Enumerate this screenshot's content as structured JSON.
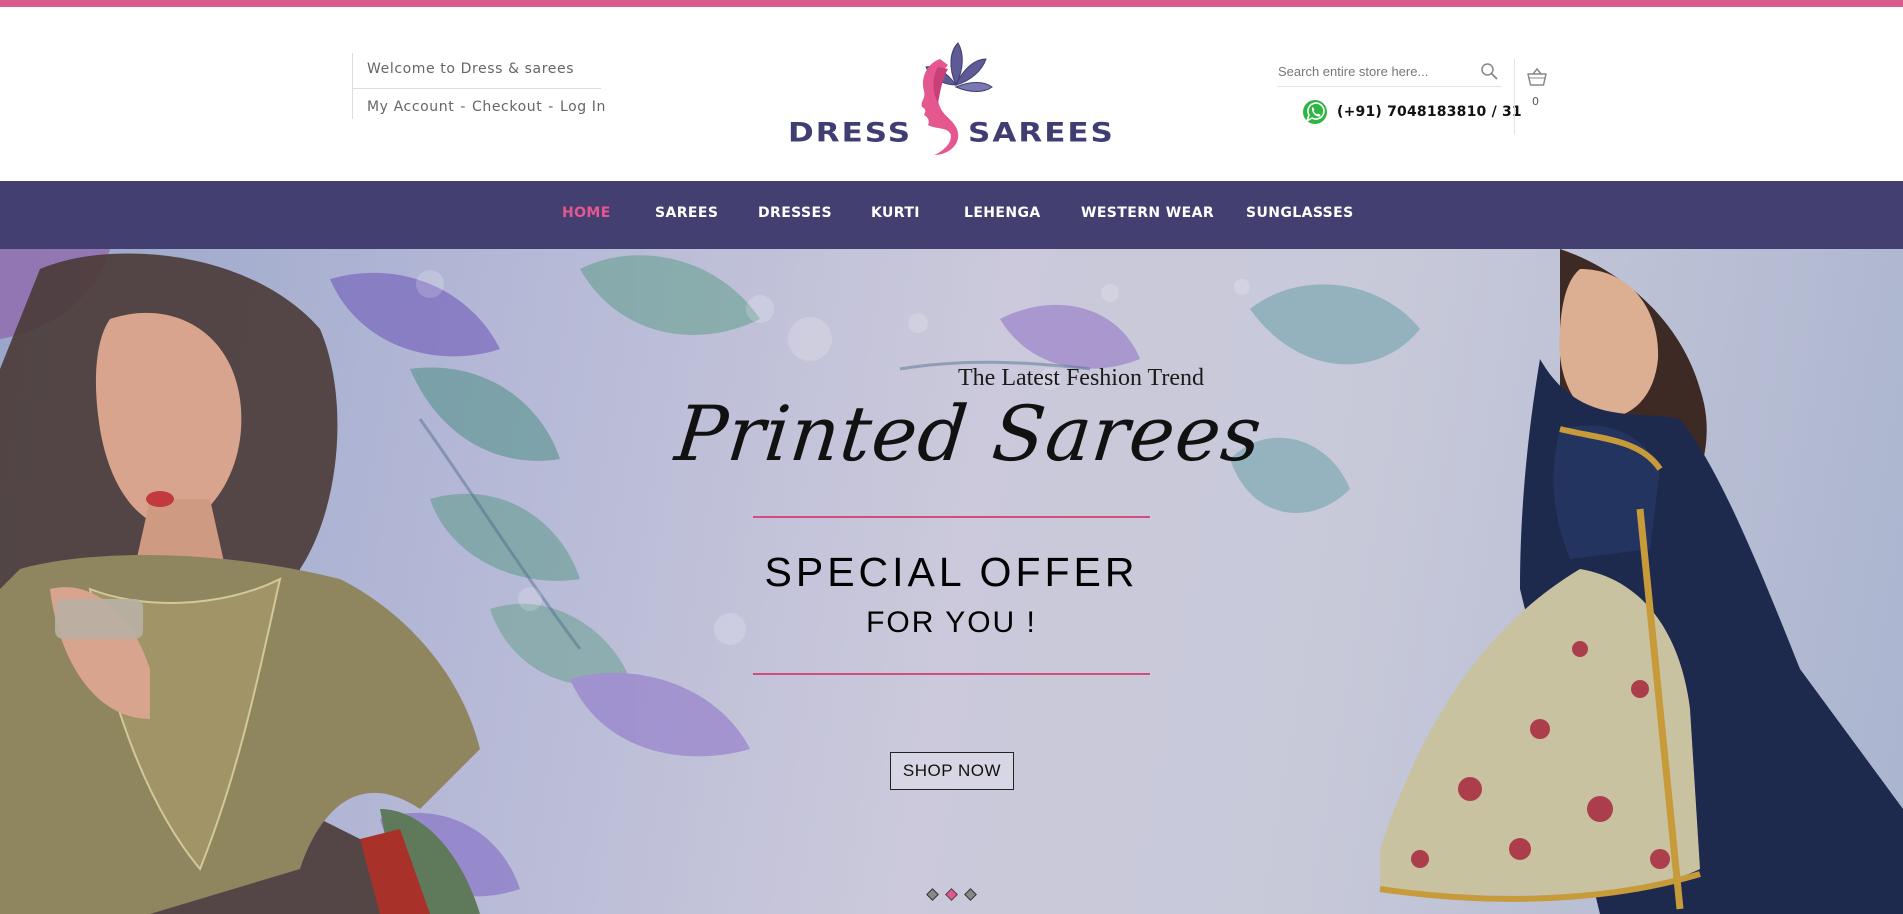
{
  "header": {
    "welcome": "Welcome to Dress & sarees",
    "account_links": [
      {
        "label": "My Account"
      },
      {
        "label": "Checkout"
      },
      {
        "label": "Log In"
      }
    ],
    "separator": "-",
    "logo": {
      "left_word": "DRESS",
      "right_word": "SAREES",
      "brand_color": "#3f3d72",
      "accent_color": "#e4578f"
    },
    "search": {
      "placeholder": "Search entire store here..."
    },
    "contact": {
      "phone": "(+91) 7048183810 / 31",
      "icon": "whatsapp-icon"
    },
    "cart": {
      "count": "0",
      "icon": "cart-icon"
    }
  },
  "nav": {
    "items": [
      {
        "label": "HOME",
        "active": true
      },
      {
        "label": "SAREES",
        "active": false
      },
      {
        "label": "DRESSES",
        "active": false
      },
      {
        "label": "KURTI",
        "active": false
      },
      {
        "label": "LEHENGA",
        "active": false
      },
      {
        "label": "WESTERN WEAR",
        "active": false
      },
      {
        "label": "SUNGLASSES",
        "active": false
      }
    ],
    "background": "#434071",
    "active_color": "#e4578f"
  },
  "hero": {
    "tagline": "The Latest Feshion Trend",
    "headline": "Printed Sarees",
    "offer": "SPECIAL OFFER",
    "subtext": "FOR YOU !",
    "button": "SHOP NOW",
    "slides_total": 3,
    "slide_active": 2,
    "rule_color": "#d44b7d"
  },
  "colors": {
    "top_strip": "#d95a8e"
  }
}
